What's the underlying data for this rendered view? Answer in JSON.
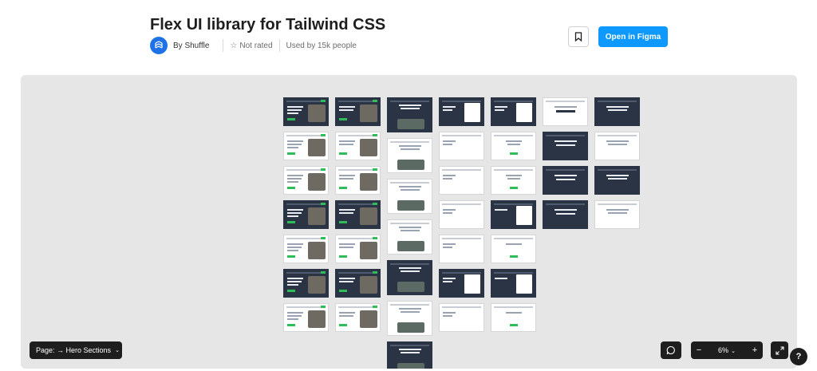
{
  "header": {
    "title": "Flex UI library for Tailwind CSS",
    "author": "By Shuffle",
    "rating": "Not rated",
    "usage": "Used by 15k people",
    "open_button": "Open in Figma"
  },
  "canvas": {
    "page_selector": "Page: → Hero Sections",
    "zoom": "6%",
    "zoom_out": "−",
    "zoom_in": "+",
    "help": "?"
  },
  "colors": {
    "accent": "#0d99ff",
    "frame_dark": "#2a3445",
    "frame_button": "#2ebd59",
    "canvas_bg": "#e6e6e6",
    "toolbar": "#1e1e1e"
  }
}
